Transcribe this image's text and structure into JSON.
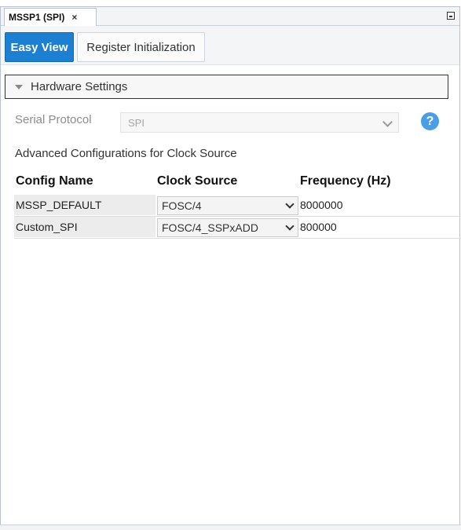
{
  "document_tab": {
    "title": "MSSP1 (SPI)",
    "close_label": "×"
  },
  "view_tabs": [
    {
      "label": "Easy View",
      "active": true
    },
    {
      "label": "Register Initialization",
      "active": false
    }
  ],
  "section": {
    "title": "Hardware Settings",
    "expanded": true
  },
  "serial_protocol": {
    "label": "Serial Protocol",
    "value": "SPI",
    "disabled": true,
    "help_label": "?"
  },
  "advanced": {
    "title": "Advanced Configurations for Clock Source",
    "columns": [
      "Config Name",
      "Clock Source",
      "Frequency (Hz)"
    ],
    "rows": [
      {
        "name": "MSSP_DEFAULT",
        "clock_source": "FOSC/4",
        "frequency": "8000000"
      },
      {
        "name": "Custom_SPI",
        "clock_source": "FOSC/4_SSPxADD",
        "frequency": "800000"
      }
    ]
  },
  "colors": {
    "accent": "#1d7fd1",
    "help": "#4a9ee4"
  }
}
